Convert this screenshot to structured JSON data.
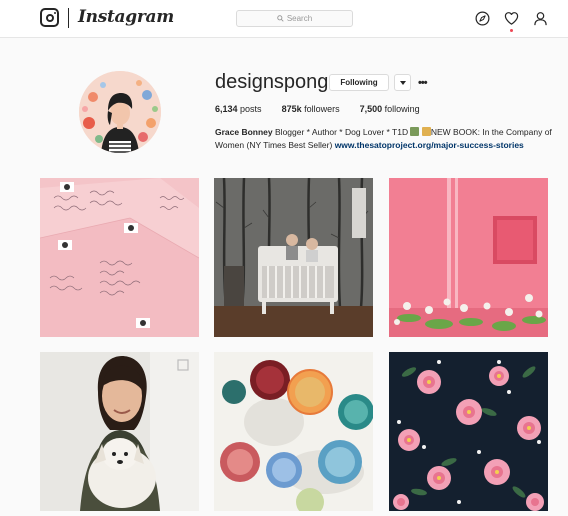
{
  "header": {
    "wordmark": "Instagram",
    "search_placeholder": "Search",
    "icons": [
      "instagram-camera-icon",
      "compass-icon",
      "heart-icon",
      "user-icon"
    ],
    "notification_color": "#ed4956"
  },
  "profile": {
    "username": "designsponge",
    "follow_label": "Following",
    "more_label": "•••",
    "stats": {
      "posts_count": "6,134",
      "posts_label": "posts",
      "followers_count": "875k",
      "followers_label": "followers",
      "following_count": "7,500",
      "following_label": "following"
    },
    "bio": {
      "name": "Grace Bonney",
      "text_1": "Blogger * Author * Dog Lover * T1D",
      "text_2": "NEW BOOK: In the Company of Women (NY Times Best Seller)",
      "link": "www.thesatoproject.org/major-success-stories"
    }
  },
  "posts": [
    {
      "subject": "pink envelopes with calligraphy"
    },
    {
      "subject": "nursery crib with tree wallpaper"
    },
    {
      "subject": "pink wall with flowers"
    },
    {
      "subject": "woman holding puppy"
    },
    {
      "subject": "colored glasses on table"
    },
    {
      "subject": "pink flowers on dark background"
    }
  ],
  "colors": {
    "link": "#003569",
    "border": "#dbdbdb",
    "text": "#262626"
  }
}
